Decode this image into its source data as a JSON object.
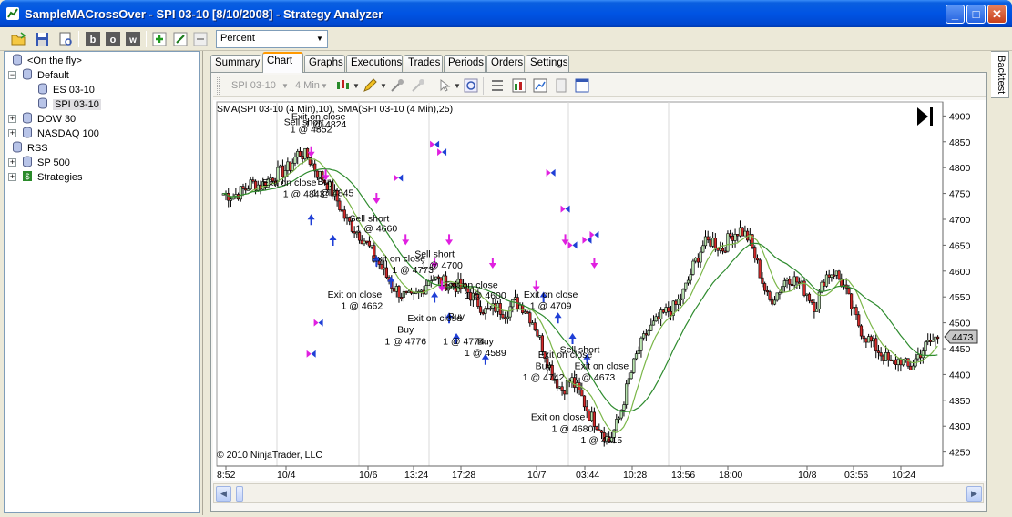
{
  "window": {
    "title": "SampleMACrossOver - SPI 03-10 [8/10/2008] - Strategy Analyzer"
  },
  "toolbar": {
    "combo_value": "Percent"
  },
  "tree": [
    {
      "label": "<On the fly>",
      "level": 1,
      "expander": "",
      "icon": "db"
    },
    {
      "label": "Default",
      "level": 0,
      "expander": "−",
      "icon": "db"
    },
    {
      "label": "ES 03-10",
      "level": 2,
      "expander": "",
      "icon": "db"
    },
    {
      "label": "SPI 03-10",
      "level": 2,
      "expander": "",
      "icon": "db",
      "selected": true
    },
    {
      "label": "DOW 30",
      "level": 0,
      "expander": "+",
      "icon": "db"
    },
    {
      "label": "NASDAQ 100",
      "level": 0,
      "expander": "+",
      "icon": "db"
    },
    {
      "label": "RSS",
      "level": 1,
      "expander": "",
      "icon": "db"
    },
    {
      "label": "SP 500",
      "level": 0,
      "expander": "+",
      "icon": "db"
    },
    {
      "label": "Strategies",
      "level": 0,
      "expander": "+",
      "icon": "strat"
    }
  ],
  "tabs": [
    "Summary",
    "Chart",
    "Graphs",
    "Executions",
    "Trades",
    "Periods",
    "Orders",
    "Settings"
  ],
  "active_tab": "Chart",
  "side_tab": "Backtest",
  "chart_toolbar": {
    "instrument": "SPI 03-10",
    "interval": "4 Min"
  },
  "chart": {
    "indicator_label": "SMA(SPI 03-10 (4 Min),10), SMA(SPI 03-10 (4 Min),25)",
    "copyright": "© 2010 NinjaTrader, LLC",
    "last_price": "4473",
    "colors": {
      "up": "#b9e4b0",
      "down": "#d42a2a",
      "sma_fast": "#7ab648",
      "sma_slow": "#2e8b2e",
      "buy": "#1f3fd6",
      "sell": "#e020e0"
    }
  },
  "chart_data": {
    "type": "candlestick",
    "title": "SMA(SPI 03-10 (4 Min),10), SMA(SPI 03-10 (4 Min),25)",
    "ylim": [
      4230,
      4920
    ],
    "y_ticks": [
      4250,
      4300,
      4350,
      4400,
      4450,
      4500,
      4550,
      4600,
      4650,
      4700,
      4750,
      4800,
      4850,
      4900
    ],
    "x_ticks": [
      "8:52",
      "10/4",
      "10/6",
      "13:24",
      "17:28",
      "10/7",
      "03:44",
      "10:28",
      "13:56",
      "18:00",
      "10/8",
      "03:56",
      "10:24"
    ],
    "price_path": [
      4750,
      4745,
      4755,
      4770,
      4765,
      4780,
      4790,
      4800,
      4830,
      4820,
      4790,
      4770,
      4740,
      4700,
      4680,
      4660,
      4630,
      4600,
      4570,
      4555,
      4545,
      4560,
      4590,
      4580,
      4575,
      4570,
      4560,
      4540,
      4520,
      4530,
      4520,
      4540,
      4530,
      4500,
      4450,
      4400,
      4370,
      4390,
      4360,
      4320,
      4300,
      4270,
      4310,
      4380,
      4440,
      4480,
      4500,
      4520,
      4530,
      4560,
      4610,
      4650,
      4660,
      4640,
      4670,
      4680,
      4660,
      4600,
      4540,
      4560,
      4590,
      4580,
      4560,
      4530,
      4590,
      4600,
      4570,
      4520,
      4480,
      4460,
      4440,
      4420,
      4430,
      4410,
      4440,
      4460,
      4473
    ],
    "annotations": [
      {
        "text": "Sell short",
        "x": 0.12,
        "price": 4882
      },
      {
        "text": "Exit on close",
        "x": 0.14,
        "price": 4893
      },
      {
        "text": "1 @ 4852",
        "x": 0.13,
        "price": 4868
      },
      {
        "text": "1 @ 4824",
        "x": 0.15,
        "price": 4878
      },
      {
        "text": "Exit on close",
        "x": 0.1,
        "price": 4765
      },
      {
        "text": "Buy",
        "x": 0.15,
        "price": 4767
      },
      {
        "text": "1 @ 4843",
        "x": 0.12,
        "price": 4743
      },
      {
        "text": "1 @ 4845",
        "x": 0.16,
        "price": 4745
      },
      {
        "text": "Sell short",
        "x": 0.21,
        "price": 4696
      },
      {
        "text": "1 @ 4660",
        "x": 0.22,
        "price": 4676
      },
      {
        "text": "Exit on close",
        "x": 0.25,
        "price": 4618
      },
      {
        "text": "1 @ 4773",
        "x": 0.27,
        "price": 4596
      },
      {
        "text": "Exit on close",
        "x": 0.19,
        "price": 4549
      },
      {
        "text": "1 @ 4662",
        "x": 0.2,
        "price": 4527
      },
      {
        "text": "Sell short",
        "x": 0.3,
        "price": 4627
      },
      {
        "text": "1 @ 4700",
        "x": 0.31,
        "price": 4605
      },
      {
        "text": "Exit on close",
        "x": 0.35,
        "price": 4567
      },
      {
        "text": "1 @ 4600",
        "x": 0.37,
        "price": 4547
      },
      {
        "text": "Exit on close",
        "x": 0.46,
        "price": 4549
      },
      {
        "text": "1 @ 4709",
        "x": 0.46,
        "price": 4527
      },
      {
        "text": "Buy",
        "x": 0.26,
        "price": 4481
      },
      {
        "text": "1 @ 4776",
        "x": 0.26,
        "price": 4458
      },
      {
        "text": "Exit on close",
        "x": 0.3,
        "price": 4503
      },
      {
        "text": "Buy",
        "x": 0.33,
        "price": 4506
      },
      {
        "text": "1 @ 4774",
        "x": 0.34,
        "price": 4458
      },
      {
        "text": "Buy",
        "x": 0.37,
        "price": 4458
      },
      {
        "text": "1 @ 4589",
        "x": 0.37,
        "price": 4436
      },
      {
        "text": "Sell short",
        "x": 0.5,
        "price": 4442
      },
      {
        "text": "Exit on close",
        "x": 0.48,
        "price": 4432
      },
      {
        "text": "Exit on close",
        "x": 0.53,
        "price": 4410
      },
      {
        "text": "Buy",
        "x": 0.45,
        "price": 4410
      },
      {
        "text": "1 @ 4673",
        "x": 0.52,
        "price": 4388
      },
      {
        "text": "1 @ 4742",
        "x": 0.45,
        "price": 4388
      },
      {
        "text": "Exit on close",
        "x": 0.47,
        "price": 4312
      },
      {
        "text": "1 @ 4680",
        "x": 0.49,
        "price": 4289
      },
      {
        "text": "1 @ 4615",
        "x": 0.53,
        "price": 4267
      }
    ]
  }
}
